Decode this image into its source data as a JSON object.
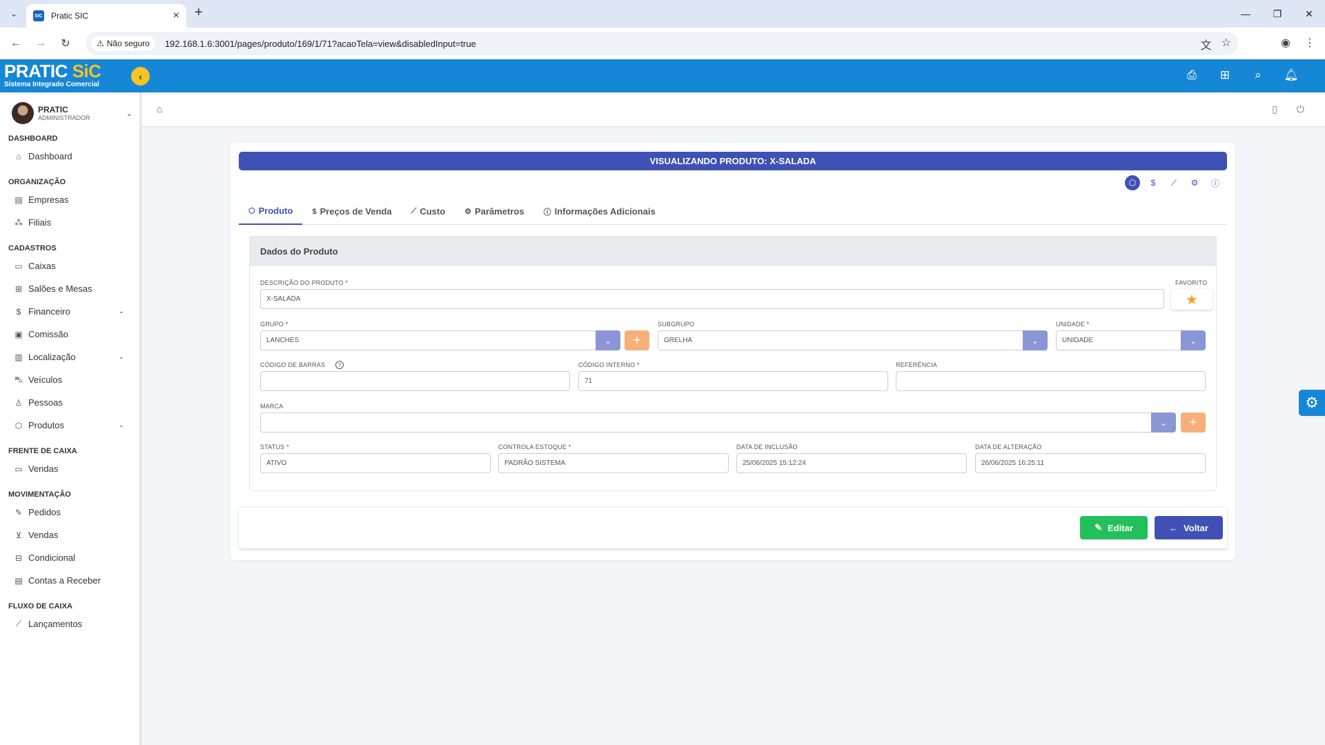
{
  "browser": {
    "tab_title": "Pratic SIC",
    "favicon_text": "SIC",
    "security_label": "Não seguro",
    "url": "192.168.1.6:3001/pages/produto/169/1/71?acaoTela=view&disabledInput=true"
  },
  "app": {
    "logo_main": "PRATIC",
    "logo_accent": "SiC",
    "logo_sub": "Sistema Integrado Comercial",
    "brand_color": "#1686d6",
    "accent_color": "#3f51b5"
  },
  "user": {
    "name": "PRATIC",
    "role": "ADMINISTRADOR"
  },
  "sidebar": {
    "sections": [
      {
        "title": "DASHBOARD",
        "items": [
          {
            "label": "Dashboard",
            "icon": "home-icon"
          }
        ]
      },
      {
        "title": "ORGANIZAÇÃO",
        "items": [
          {
            "label": "Empresas",
            "icon": "building-icon"
          },
          {
            "label": "Filiais",
            "icon": "network-icon"
          }
        ]
      },
      {
        "title": "CADASTROS",
        "items": [
          {
            "label": "Caixas",
            "icon": "monitor-icon"
          },
          {
            "label": "Salões e Mesas",
            "icon": "grid-icon"
          },
          {
            "label": "Financeiro",
            "icon": "dollar-icon",
            "expandable": true
          },
          {
            "label": "Comissão",
            "icon": "money-icon"
          },
          {
            "label": "Localização",
            "icon": "map-icon",
            "expandable": true
          },
          {
            "label": "Veículos",
            "icon": "car-icon"
          },
          {
            "label": "Pessoas",
            "icon": "user-icon"
          },
          {
            "label": "Produtos",
            "icon": "box-icon",
            "expandable": true
          }
        ]
      },
      {
        "title": "FRENTE DE CAIXA",
        "items": [
          {
            "label": "Vendas",
            "icon": "monitor-icon"
          }
        ]
      },
      {
        "title": "MOVIMENTAÇÃO",
        "items": [
          {
            "label": "Pedidos",
            "icon": "edit-icon"
          },
          {
            "label": "Vendas",
            "icon": "cart-icon"
          },
          {
            "label": "Condicional",
            "icon": "briefcase-icon"
          },
          {
            "label": "Contas a Receber",
            "icon": "receipt-icon"
          }
        ]
      },
      {
        "title": "FLUXO DE CAIXA",
        "items": [
          {
            "label": "Lançamentos",
            "icon": "chart-icon"
          }
        ]
      }
    ]
  },
  "page": {
    "title": "VISUALIZANDO PRODUTO:  X-SALADA",
    "tabs": [
      {
        "label": "Produto",
        "icon": "box-icon",
        "active": true
      },
      {
        "label": "Preços de Venda",
        "icon": "dollar-icon"
      },
      {
        "label": "Custo",
        "icon": "chart-icon"
      },
      {
        "label": "Parâmetros",
        "icon": "gear-icon"
      },
      {
        "label": "Informações Adicionais",
        "icon": "info-icon"
      }
    ],
    "panel_title": "Dados do Produto",
    "fields": {
      "descricao": {
        "label": "DESCRIÇÃO DO PRODUTO *",
        "value": "X-SALADA"
      },
      "favorito": {
        "label": "FAVORITO"
      },
      "grupo": {
        "label": "GRUPO *",
        "value": "LANCHES"
      },
      "subgrupo": {
        "label": "SUBGRUPO",
        "value": "GRELHA"
      },
      "unidade": {
        "label": "UNIDADE *",
        "value": "UNIDADE"
      },
      "codigo_barras": {
        "label": "CÓDIGO DE BARRAS",
        "value": ""
      },
      "codigo_interno": {
        "label": "CÓDIGO INTERNO *",
        "value": "71"
      },
      "referencia": {
        "label": "REFERÊNCIA",
        "value": ""
      },
      "marca": {
        "label": "MARCA",
        "value": ""
      },
      "status": {
        "label": "STATUS *",
        "value": "ATIVO"
      },
      "controla_estoque": {
        "label": "CONTROLA ESTOQUE *",
        "value": "PADRÃO SISTEMA"
      },
      "data_inclusao": {
        "label": "DATA DE INCLUSÃO",
        "value": "25/06/2025 15:12:24"
      },
      "data_alteracao": {
        "label": "DATA DE ALTERAÇÃO",
        "value": "26/06/2025 16:25:11"
      }
    },
    "buttons": {
      "edit": "Editar",
      "back": "Voltar"
    }
  }
}
